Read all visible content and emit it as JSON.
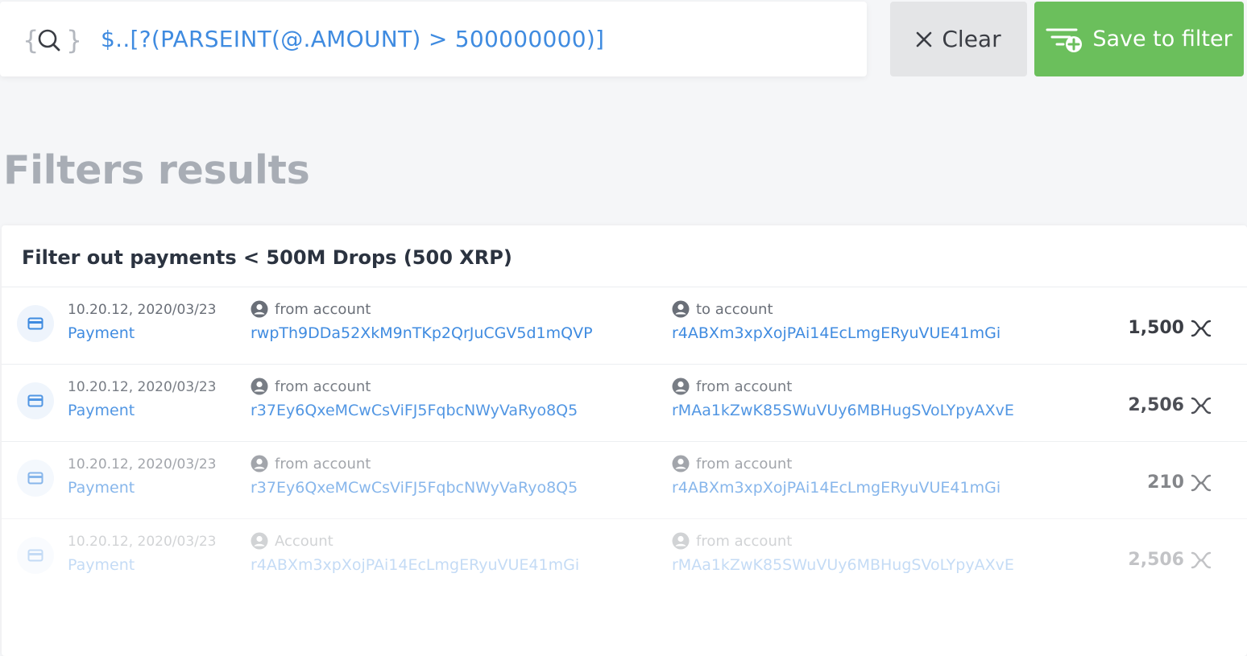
{
  "search": {
    "icon": "json-search-icon",
    "query": "$..[?(PARSEINT(@.AMOUNT) > 500000000)]"
  },
  "toolbar": {
    "clear_label": "Clear",
    "save_label": "Save to filter",
    "save_color": "#6bbf5c",
    "clear_color": "#e4e5e7"
  },
  "page": {
    "title": "Filters results"
  },
  "results": {
    "filter_name": "Filter out payments < 500M Drops (500 XRP)",
    "rows": [
      {
        "time": "10.20.12, 2020/03/23",
        "type": "Payment",
        "left_label": "from account",
        "left_account": "rwpTh9DDa52XkM9nTKp2QrJuCGV5d1mQVP",
        "right_label": "to account",
        "right_account": "r4ABXm3xpXojPAi14EcLmgERyuVUE41mGi",
        "amount": "1,500",
        "currency_icon": "xrp-icon"
      },
      {
        "time": "10.20.12, 2020/03/23",
        "type": "Payment",
        "left_label": "from account",
        "left_account": "r37Ey6QxeMCwCsViFJ5FqbcNWyVaRyo8Q5",
        "right_label": "from account",
        "right_account": "rMAa1kZwK85SWuVUy6MBHugSVoLYpyAXvE",
        "amount": "2,506",
        "currency_icon": "xrp-icon"
      },
      {
        "time": "10.20.12, 2020/03/23",
        "type": "Payment",
        "left_label": "from account",
        "left_account": "r37Ey6QxeMCwCsViFJ5FqbcNWyVaRyo8Q5",
        "right_label": "from account",
        "right_account": "r4ABXm3xpXojPAi14EcLmgERyuVUE41mGi",
        "amount": "210",
        "currency_icon": "xrp-icon"
      },
      {
        "time": "10.20.12, 2020/03/23",
        "type": "Payment",
        "left_label": "Account",
        "left_account": "r4ABXm3xpXojPAi14EcLmgERyuVUE41mGi",
        "right_label": "from account",
        "right_account": "rMAa1kZwK85SWuVUy6MBHugSVoLYpyAXvE",
        "amount": "2,506",
        "currency_icon": "xrp-icon"
      }
    ]
  }
}
